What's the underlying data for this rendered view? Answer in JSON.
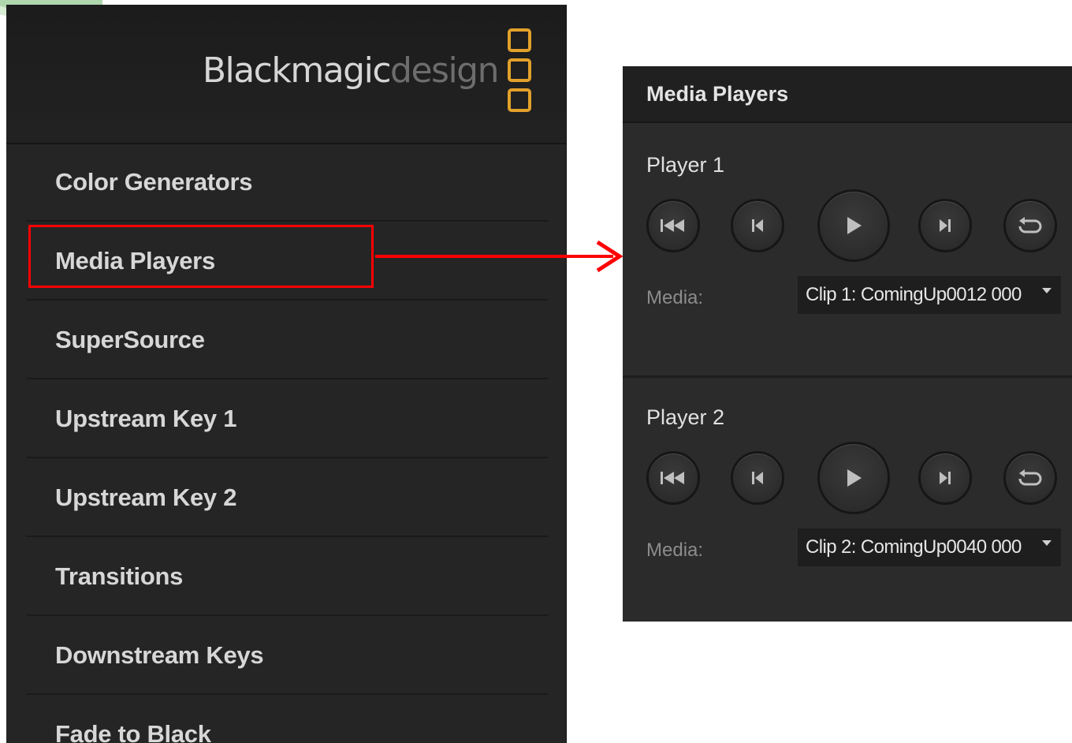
{
  "logo": {
    "brand_text": "Blackmagic",
    "brand_text_light": "design"
  },
  "menu": {
    "items": [
      {
        "label": "Color Generators"
      },
      {
        "label": "Media Players"
      },
      {
        "label": "SuperSource"
      },
      {
        "label": "Upstream Key 1"
      },
      {
        "label": "Upstream Key 2"
      },
      {
        "label": "Transitions"
      },
      {
        "label": "Downstream Keys"
      },
      {
        "label": "Fade to Black"
      }
    ],
    "highlighted_item": "Media Players"
  },
  "panel": {
    "title": "Media Players",
    "players": [
      {
        "title": "Player 1",
        "media_label": "Media:",
        "media_value": "Clip 1: ComingUp0012 000"
      },
      {
        "title": "Player 2",
        "media_label": "Media:",
        "media_value": "Clip 2: ComingUp0040 000"
      }
    ]
  },
  "controls": [
    "rewind-icon",
    "previous-frame-icon",
    "play-icon",
    "next-frame-icon",
    "loop-icon"
  ],
  "colors": {
    "highlight": "#ff0000",
    "logo_accent": "#e2a12b",
    "panel_bg": "#2b2b2b",
    "menu_bg": "#252525"
  }
}
